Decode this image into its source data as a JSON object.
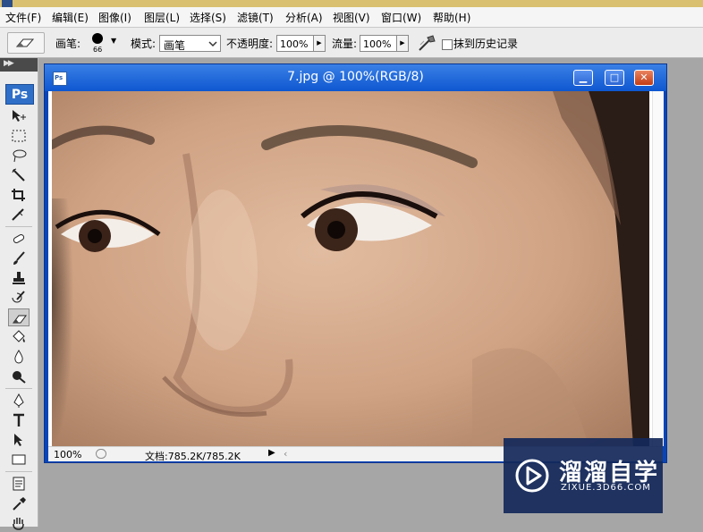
{
  "menu": [
    "文件(F)",
    "编辑(E)",
    "图像(I)",
    "图层(L)",
    "选择(S)",
    "滤镜(T)",
    "分析(A)",
    "视图(V)",
    "窗口(W)",
    "帮助(H)"
  ],
  "options": {
    "brush_label": "画笔:",
    "brush_size": "66",
    "mode_label": "模式:",
    "mode_value": "画笔",
    "opacity_label": "不透明度:",
    "opacity_value": "100%",
    "flow_label": "流量:",
    "flow_value": "100%",
    "erase_history_label": "抹到历史记录"
  },
  "toolbox": {
    "logo": "Ps",
    "tools": [
      "move-icon",
      "marquee-icon",
      "lasso-icon",
      "magic-wand-icon",
      "crop-icon",
      "slice-icon",
      "healing-icon",
      "brush-icon",
      "stamp-icon",
      "history-brush-icon",
      "eraser-icon",
      "bucket-icon",
      "blur-icon",
      "dodge-icon",
      "pen-icon",
      "type-icon",
      "path-select-icon",
      "shape-icon",
      "notes-icon",
      "eyedropper-icon",
      "hand-icon"
    ],
    "selected": "eraser-icon"
  },
  "document": {
    "title": "7.jpg @ 100%(RGB/8)",
    "icon_label": "Ps",
    "zoom": "100%",
    "doc_info": "文档:785.2K/785.2K"
  },
  "watermark": {
    "name": "溜溜自学",
    "url": "ZIXUE.3D66.COM"
  },
  "colors": {
    "title_bar": "#0e57d0",
    "accent": "#2f6fc8",
    "workspace": "#a6a6a6"
  }
}
